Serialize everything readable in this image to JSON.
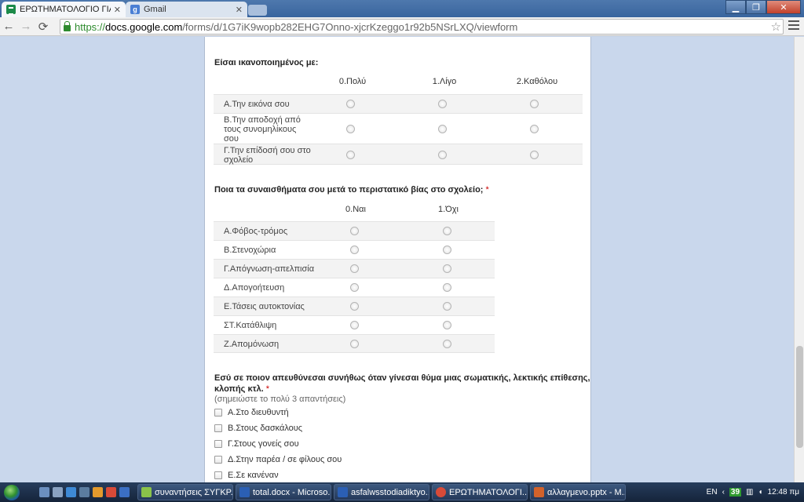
{
  "browser": {
    "tabs": [
      {
        "title": "ΕΡΩΤΗΜΑΤΟΛΟΓΙΟ ΓΙΑ ΤΗ",
        "active": true
      },
      {
        "title": "Gmail",
        "active": false
      }
    ],
    "url": {
      "scheme": "https://",
      "host": "docs.google.com",
      "path": "/forms/d/1G7iK9wopb282EHG7Onno-xjcrKzeggo1r92b5NSrLXQ/viewform"
    }
  },
  "form": {
    "q1": {
      "title": "Είσαι ικανοποιημένος με:",
      "columns": [
        "0.Πολύ",
        "1.Λίγο",
        "2.Καθόλου"
      ],
      "rows": [
        [
          "Α.Την εικόνα σου"
        ],
        [
          "Β.Την αποδοχή από",
          "τους συνομηλίκους",
          "σου"
        ],
        [
          "Γ.Την επίδοσή σου στο",
          "σχολείο"
        ]
      ]
    },
    "q2": {
      "title": "Ποια τα συναισθήματα σου μετά το περιστατικό βίας στο σχολείο;",
      "required_mark": "*",
      "columns": [
        "0.Ναι",
        "1.Όχι"
      ],
      "rows": [
        "Α.Φόβος-τρόμος",
        "Β.Στενοχώρια",
        "Γ.Απόγνωση-απελπισία",
        "Δ.Απογοήτευση",
        "Ε.Τάσεις αυτοκτονίας",
        "ΣΤ.Κατάθλιψη",
        "Ζ.Απομόνωση"
      ]
    },
    "q3": {
      "title_line1": "Εσύ σε ποιον απευθύνεσαι συνήθως όταν γίνεσαι θύμα μιας σωματικής, λεκτικής επίθεσης,",
      "title_line2": "κλοπής κτλ.",
      "required_mark": "*",
      "help": "(σημειώστε το πολύ 3 απαντήσεις)",
      "options": [
        "Α.Στο διευθυντή",
        "Β.Στους δασκάλους",
        "Γ.Στους γονείς σου",
        "Δ.Στην παρέα / σε φίλους σου",
        "Ε.Σε κανέναν"
      ]
    }
  },
  "taskbar": {
    "tasks": [
      "συναντήσεις ΣΥΓΚΡ...",
      "total.docx - Microso...",
      "asfalwsstodiadiktyo....",
      "ΕΡΩΤΗΜΑΤΟΛΟΓΙ...",
      "αλλαγμενο.pptx - M..."
    ],
    "language": "EN",
    "tray_badge": "39",
    "clock": "12:48 πμ"
  },
  "colors": {
    "page_background": "#c9d7ec",
    "required": "#cc0000",
    "https_green": "#2e8b2e"
  }
}
